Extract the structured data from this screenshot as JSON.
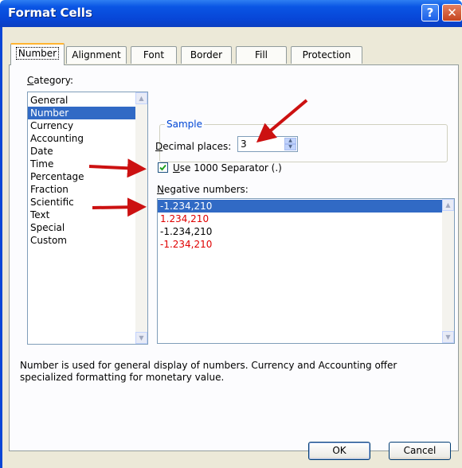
{
  "window": {
    "title": "Format Cells",
    "help_glyph": "?",
    "close_glyph": "✕"
  },
  "tabs": [
    {
      "label": "Number",
      "active": true
    },
    {
      "label": "Alignment"
    },
    {
      "label": "Font"
    },
    {
      "label": "Border"
    },
    {
      "label": "Fill"
    },
    {
      "label": "Protection"
    }
  ],
  "category": {
    "label_first": "C",
    "label_rest": "ategory:",
    "items": [
      "General",
      "Number",
      "Currency",
      "Accounting",
      "Date",
      "Time",
      "Percentage",
      "Fraction",
      "Scientific",
      "Text",
      "Special",
      "Custom"
    ],
    "selected": "Number"
  },
  "sample": {
    "title": "Sample",
    "value": ""
  },
  "decimal_places": {
    "label_first": "D",
    "label_rest": "ecimal places:",
    "value": "3"
  },
  "separator": {
    "label_first": "U",
    "label_rest": "se 1000 Separator (.)",
    "checked": true
  },
  "negative_numbers": {
    "label_first": "N",
    "label_rest": "egative numbers:",
    "items": [
      {
        "text": "-1.234,210",
        "color": "#000000",
        "selected": true
      },
      {
        "text": "1.234,210",
        "color": "#e00000"
      },
      {
        "text": "-1.234,210",
        "color": "#000000"
      },
      {
        "text": "-1.234,210",
        "color": "#e00000"
      }
    ]
  },
  "description": "Number is used for general display of numbers.  Currency and Accounting offer specialized formatting for monetary value.",
  "buttons": {
    "ok": "OK",
    "cancel": "Cancel"
  },
  "colors": {
    "title_bar": "#0a55e4",
    "selection": "#316ac5",
    "annotation_arrow": "#cc1111",
    "active_tab_highlight": "#ffb431"
  }
}
